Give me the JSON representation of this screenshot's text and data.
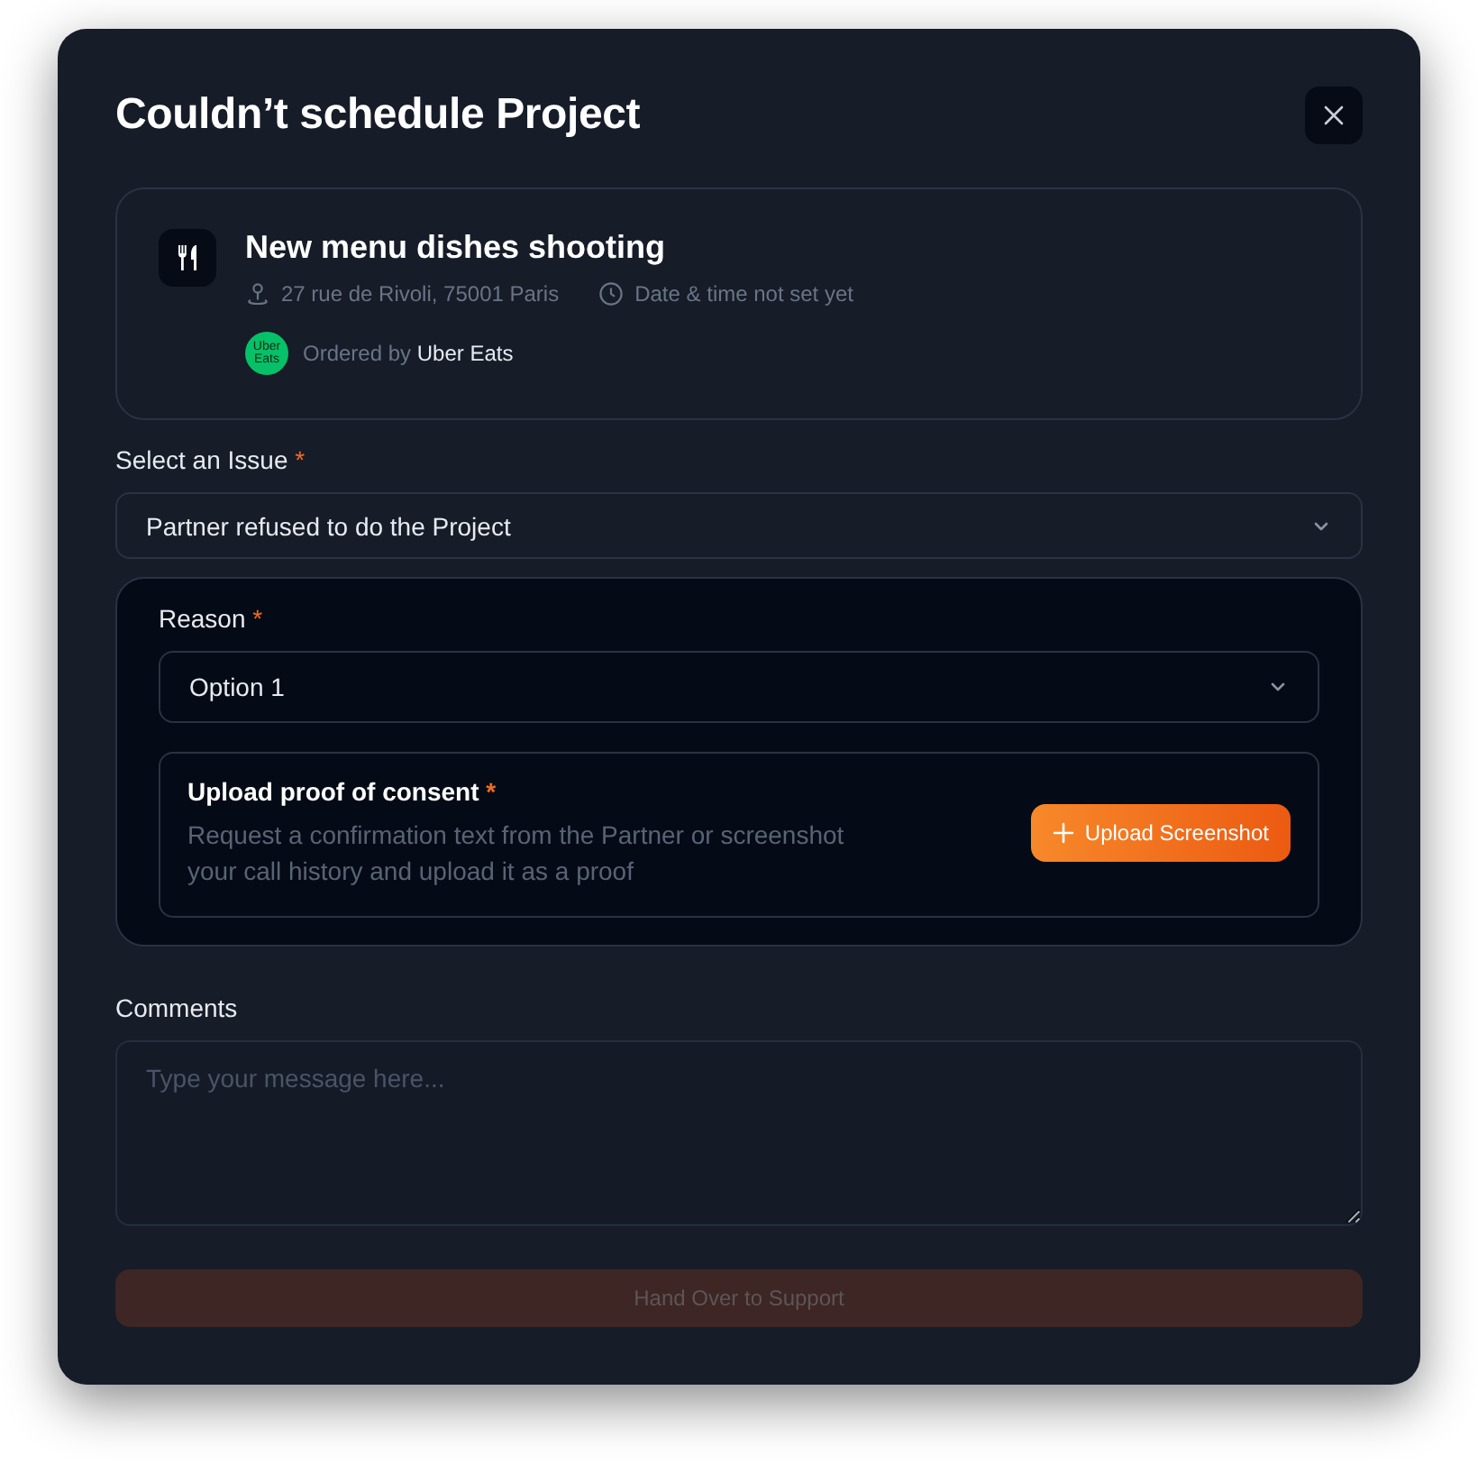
{
  "dialog": {
    "title": "Couldn’t schedule Project"
  },
  "project": {
    "name": "New menu dishes shooting",
    "address": "27 rue de Rivoli, 75001 Paris",
    "datetime": "Date & time not set yet",
    "ordered_by_label": "Ordered by",
    "client": "Uber Eats",
    "client_logo": [
      "Uber",
      "Eats"
    ]
  },
  "issue": {
    "label": "Select an Issue",
    "required_mark": "*",
    "value": "Partner refused to do the Project"
  },
  "reason": {
    "label": "Reason",
    "required_mark": "*",
    "value": "Option 1"
  },
  "upload": {
    "title": "Upload proof of consent",
    "required_mark": "*",
    "description": "Request a confirmation text from the Partner or screenshot your call history and upload it as a proof",
    "button": "Upload Screenshot"
  },
  "comments": {
    "label": "Comments",
    "placeholder": "Type your message here..."
  },
  "submit": {
    "label": "Hand Over to Support",
    "disabled": true
  }
}
